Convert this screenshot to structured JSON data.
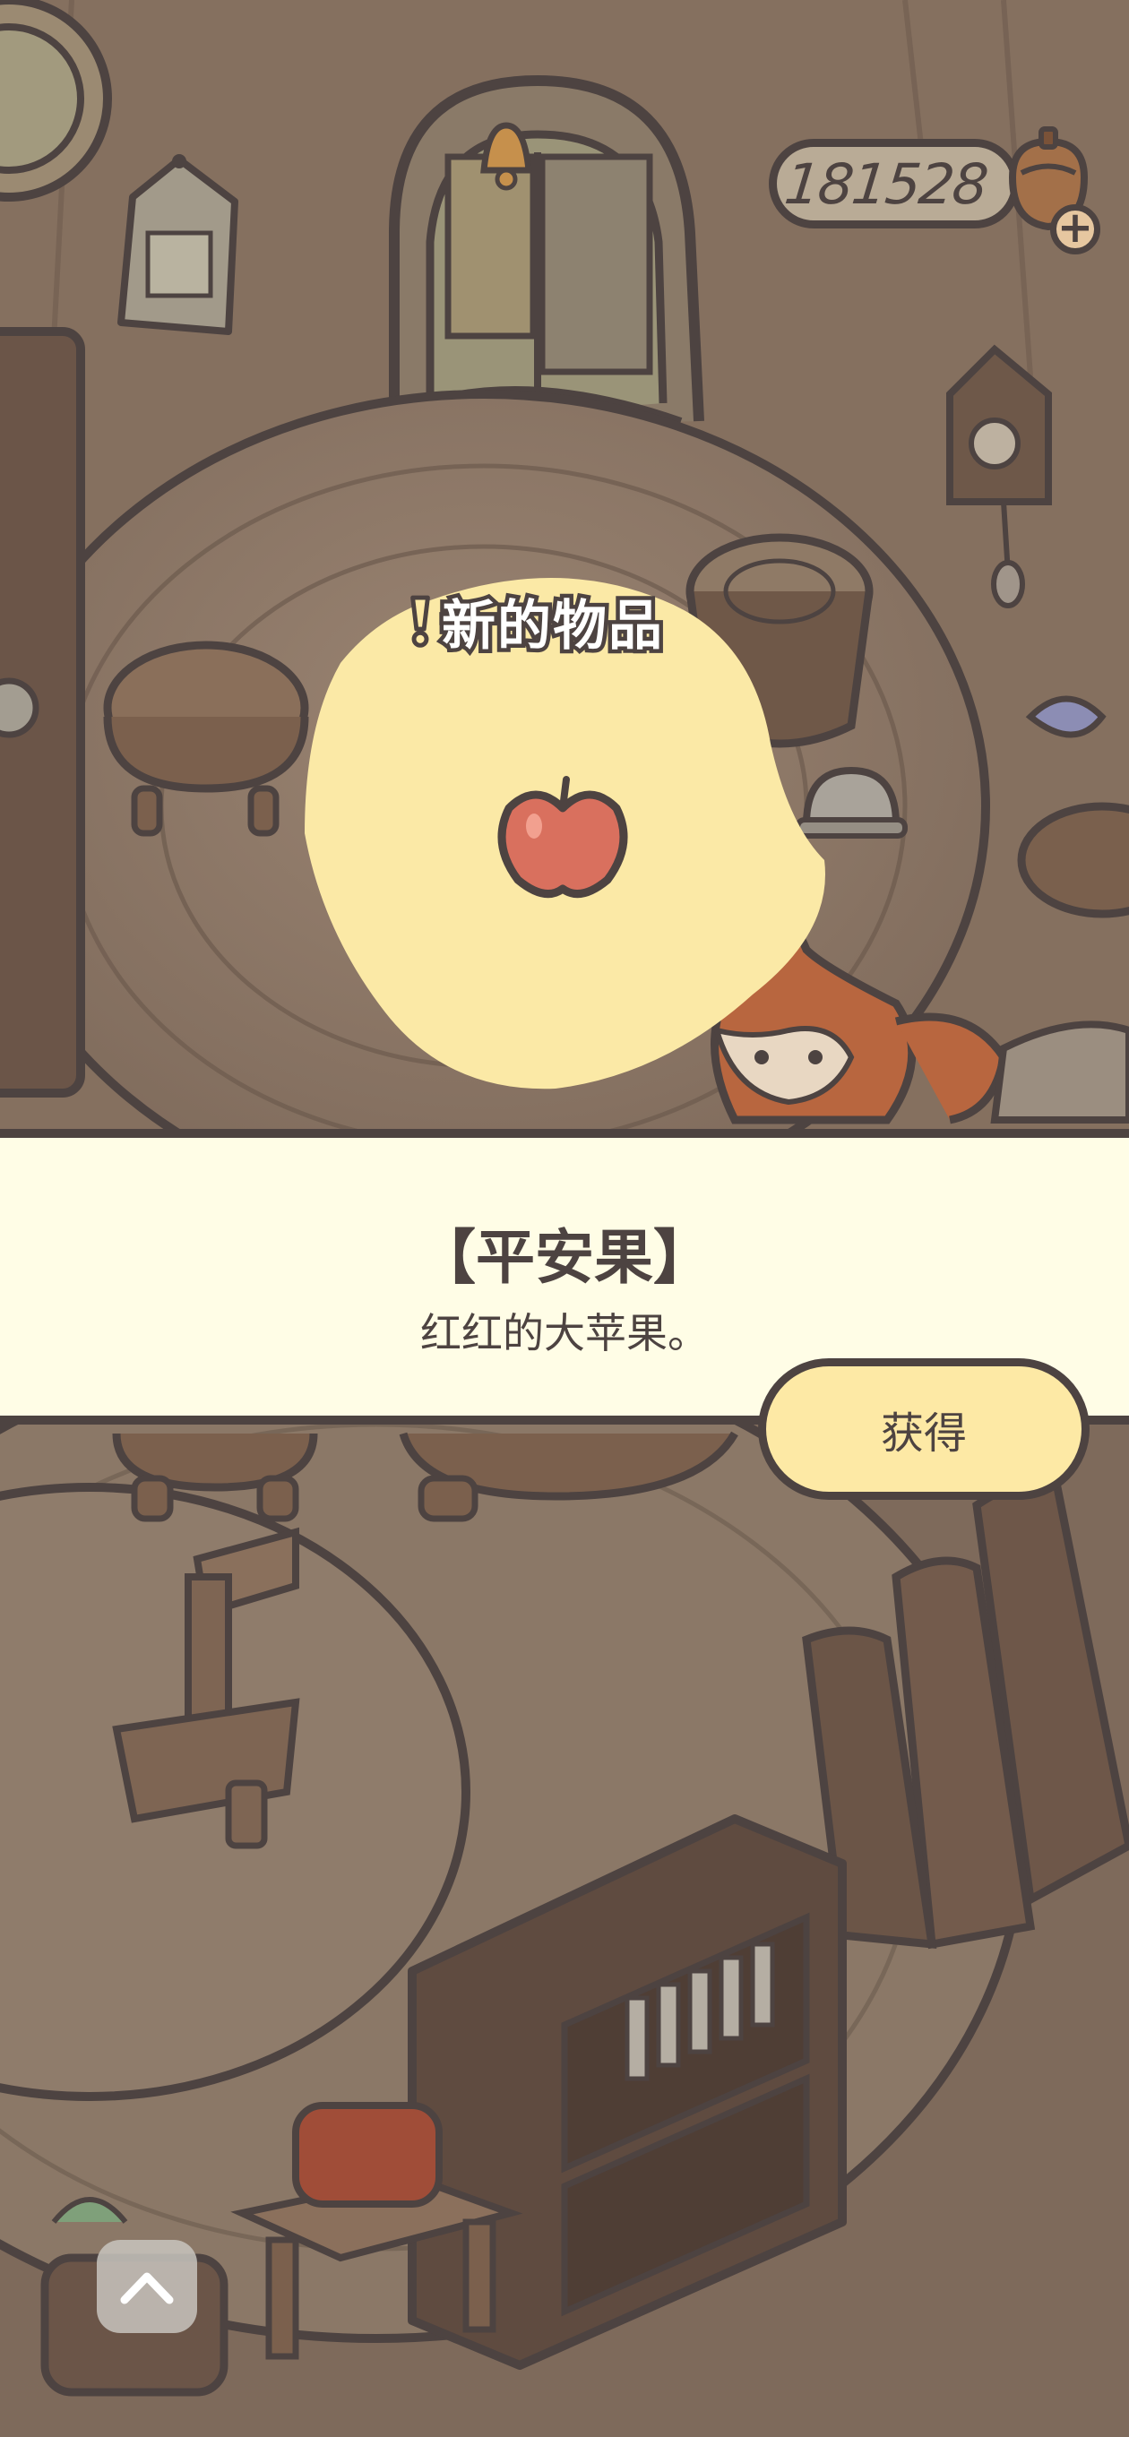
{
  "hud": {
    "coin_count": "181528",
    "add_label": "+"
  },
  "popup": {
    "heading": "新的物品",
    "item_name": "【平安果】",
    "item_description": "红红的大苹果。",
    "obtain_label": "获得",
    "item_icon": "apple-icon"
  },
  "controls": {
    "collapse_icon": "chevron-up-icon"
  },
  "colors": {
    "outline": "#4d4341",
    "panel_bg": "#fffde6",
    "button_bg": "#fde9a5",
    "blob": "#fbe9a6",
    "apple": "#d9705e",
    "scene_dim": "#7a6659"
  }
}
